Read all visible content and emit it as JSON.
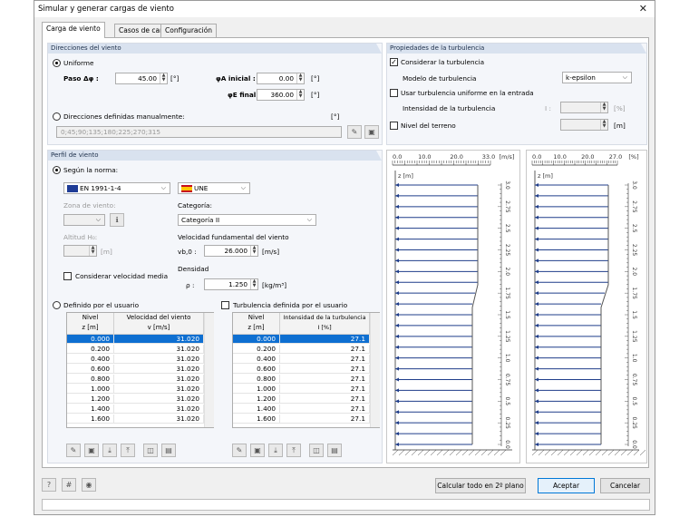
{
  "window": {
    "title": "Simular y generar cargas de viento",
    "close": "✕"
  },
  "tabs": [
    "Carga de viento",
    "Casos de carga",
    "Configuración"
  ],
  "directions": {
    "header": "Direcciones del viento",
    "uniform": "Uniforme",
    "step_label": "Paso Δφ :",
    "step_value": "45.00",
    "step_unit": "[°]",
    "phiA_label": "φA inicial :",
    "phiA_value": "0.00",
    "phiA_unit": "[°]",
    "phiE_label": "φE final:",
    "phiE_value": "360.00",
    "phiE_unit": "[°]",
    "manual": "Direcciones definidas manualmente:",
    "manual_unit": "[°]",
    "manual_value": "0;45;90;135;180;225;270;315"
  },
  "turbulence": {
    "header": "Propiedades de la turbulencia",
    "consider": "Considerar la turbulencia",
    "model_label": "Modelo de turbulencia",
    "model_value": "k-epsilon",
    "uniform": "Usar turbulencia uniforme en la entrada",
    "intensity_label": "Intensidad de la turbulencia",
    "intensity_sym": "I :",
    "intensity_unit": "[%]",
    "terrain": "Nivel del terreno",
    "terrain_unit": "[m]"
  },
  "profile": {
    "header": "Perfil de viento",
    "by_norm": "Según la norma:",
    "norm": "EN 1991-1-4",
    "annex": "UNE",
    "zone_label": "Zona de viento:",
    "category_label": "Categoría:",
    "category_value": "Categoría II",
    "altitude_label": "Altitud H₀:",
    "altitude_unit": "[m]",
    "vb_label": "Velocidad fundamental del viento",
    "vb_sym": "vb,0 :",
    "vb_value": "26.000",
    "vb_unit": "[m/s]",
    "density_label": "Densidad",
    "rho_sym": "ρ :",
    "rho_value": "1.250",
    "rho_unit": "[kg/m³]",
    "consider_mean": "Considerar velocidad media",
    "user_defined": "Definido por el usuario",
    "user_turb": "Turbulencia definida por el usuario"
  },
  "table1": {
    "col1": "Nivel",
    "col1u": "z [m]",
    "col2": "Velocidad del viento",
    "col2u": "v [m/s]",
    "rows": [
      [
        "0.000",
        "31.020"
      ],
      [
        "0.200",
        "31.020"
      ],
      [
        "0.400",
        "31.020"
      ],
      [
        "0.600",
        "31.020"
      ],
      [
        "0.800",
        "31.020"
      ],
      [
        "1.000",
        "31.020"
      ],
      [
        "1.200",
        "31.020"
      ],
      [
        "1.400",
        "31.020"
      ],
      [
        "1.600",
        "31.020"
      ]
    ]
  },
  "table2": {
    "col1": "Nivel",
    "col1u": "z [m]",
    "col2": "Intensidad de la turbulencia",
    "col2u": "I [%]",
    "rows": [
      [
        "0.000",
        "27.1"
      ],
      [
        "0.200",
        "27.1"
      ],
      [
        "0.400",
        "27.1"
      ],
      [
        "0.600",
        "27.1"
      ],
      [
        "0.800",
        "27.1"
      ],
      [
        "1.000",
        "27.1"
      ],
      [
        "1.200",
        "27.1"
      ],
      [
        "1.400",
        "27.1"
      ],
      [
        "1.600",
        "27.1"
      ]
    ]
  },
  "chart_data": [
    {
      "type": "line",
      "xlabel": "[m/s]",
      "ylabel": "z [m]",
      "xticks": [
        "0.0",
        "10.0",
        "20.0",
        "33.0"
      ],
      "yticks": [
        "3.0",
        "2.75",
        "2.5",
        "2.25",
        "2.0",
        "1.75",
        "1.5",
        "1.25",
        "1.0",
        "0.75",
        "0.5",
        "0.25",
        "0.0"
      ]
    },
    {
      "type": "line",
      "xlabel": "[%]",
      "ylabel": "z [m]",
      "xticks": [
        "0.0",
        "10.0",
        "20.0",
        "27.0"
      ],
      "yticks": [
        "3.0",
        "2.75",
        "2.5",
        "2.25",
        "2.0",
        "1.75",
        "1.5",
        "1.25",
        "1.0",
        "0.75",
        "0.5",
        "0.25",
        "0.0"
      ]
    }
  ],
  "buttons": {
    "calc": "Calcular todo en 2º plano",
    "ok": "Aceptar",
    "cancel": "Cancelar"
  }
}
